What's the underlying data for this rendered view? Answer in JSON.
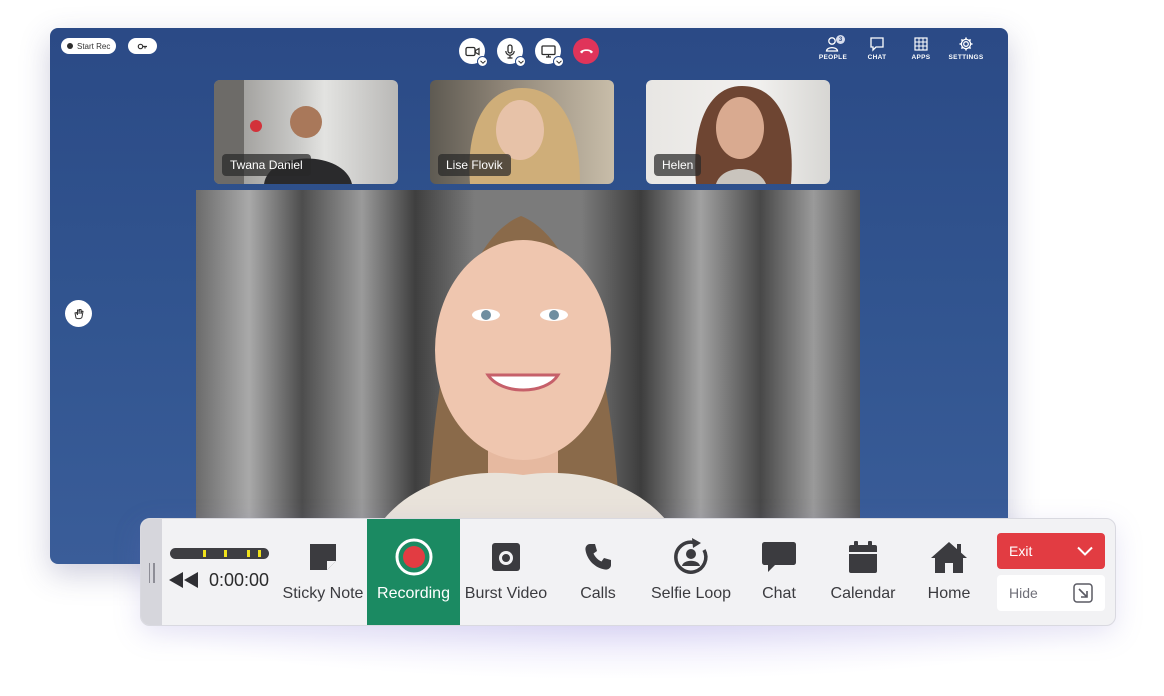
{
  "meeting": {
    "start_rec_label": "Start Rec",
    "nav": [
      {
        "label": "PEOPLE",
        "icon": "people-icon",
        "badge": "3"
      },
      {
        "label": "CHAT",
        "icon": "chat-icon"
      },
      {
        "label": "APPS",
        "icon": "apps-grid-icon"
      },
      {
        "label": "SETTINGS",
        "icon": "settings-gear-icon"
      }
    ],
    "controls": [
      "camera-icon",
      "microphone-icon",
      "screen-share-icon",
      "end-call-icon"
    ],
    "participants": [
      {
        "name": "Twana Daniel"
      },
      {
        "name": "Lise Flovik"
      },
      {
        "name": "Helen"
      }
    ],
    "colors": {
      "background": "#2b4a86",
      "end_call": "#e0345a"
    }
  },
  "toolbar": {
    "time": "0:00:00",
    "tools": [
      {
        "label": "Sticky Note",
        "icon": "sticky-note-icon"
      },
      {
        "label": "Recording",
        "icon": "record-icon",
        "active": true
      },
      {
        "label": "Burst Video",
        "icon": "burst-video-icon"
      },
      {
        "label": "Calls",
        "icon": "phone-icon"
      },
      {
        "label": "Selfie Loop",
        "icon": "selfie-loop-icon"
      },
      {
        "label": "Chat",
        "icon": "chat-bubble-icon"
      },
      {
        "label": "Calendar",
        "icon": "calendar-icon"
      },
      {
        "label": "Home",
        "icon": "home-icon"
      }
    ],
    "exit_label": "Exit",
    "hide_label": "Hide",
    "colors": {
      "active": "#1b8a62",
      "exit": "#e23c42",
      "marker": "#f0e21a"
    }
  }
}
